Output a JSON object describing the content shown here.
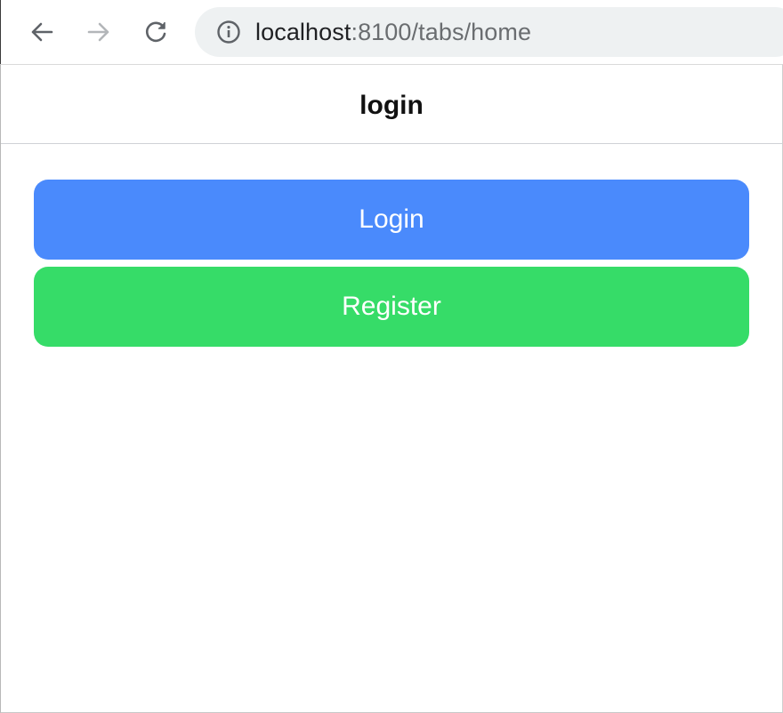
{
  "browser": {
    "url_host": "localhost",
    "url_rest": ":8100/tabs/home",
    "back_icon": "arrow-left-icon",
    "forward_icon": "arrow-right-icon",
    "reload_icon": "reload-icon",
    "info_icon": "info-icon"
  },
  "header": {
    "title": "login"
  },
  "buttons": {
    "login_label": "Login",
    "register_label": "Register"
  },
  "colors": {
    "login": "#4a8afc",
    "register": "#36dc68"
  }
}
